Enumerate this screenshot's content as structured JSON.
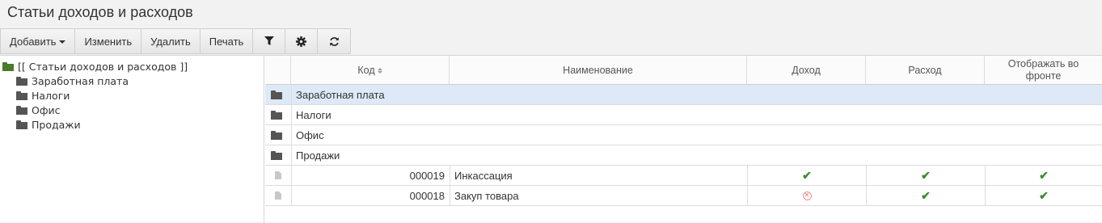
{
  "page": {
    "title": "Статьи доходов и расходов"
  },
  "toolbar": {
    "add_label": "Добавить",
    "edit_label": "Изменить",
    "delete_label": "Удалить",
    "print_label": "Печать"
  },
  "tree": {
    "root_label": "[[ Статьи доходов и расходов ]]",
    "items": [
      {
        "label": "Заработная плата"
      },
      {
        "label": "Налоги"
      },
      {
        "label": "Офис"
      },
      {
        "label": "Продажи"
      }
    ]
  },
  "grid": {
    "columns": {
      "code": "Код",
      "name": "Наименование",
      "income": "Доход",
      "expense": "Расход",
      "show_front": "Отображать во фронте"
    },
    "folder_rows": [
      {
        "name": "Заработная плата",
        "selected": true
      },
      {
        "name": "Налоги"
      },
      {
        "name": "Офис"
      },
      {
        "name": "Продажи"
      }
    ],
    "item_rows": [
      {
        "code": "000019",
        "name": "Инкассация",
        "income": "check",
        "expense": "check",
        "show_front": "check"
      },
      {
        "code": "000018",
        "name": "Закуп товара",
        "income": "cross",
        "expense": "check",
        "show_front": "check"
      }
    ]
  },
  "colors": {
    "check": "#3d8c2d",
    "cross": "#e07070",
    "selected_row": "#dde9f6"
  }
}
